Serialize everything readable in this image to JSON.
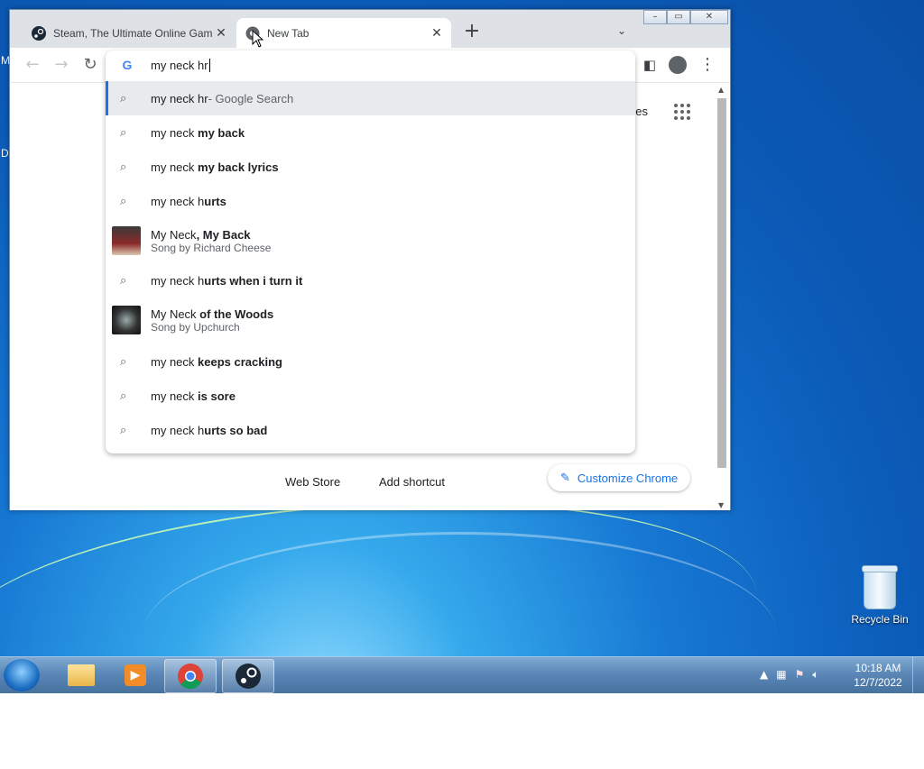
{
  "browser": {
    "tabs": [
      {
        "title": "Steam, The Ultimate Online Gam",
        "icon": "steam-icon"
      },
      {
        "title": "New Tab",
        "icon": "chrome-icon"
      }
    ],
    "omnibox": {
      "value": "my neck hr"
    },
    "suggestions": [
      {
        "type": "search",
        "typed": "my neck hr",
        "rest": "",
        "suffix": " - Google Search",
        "selected": true
      },
      {
        "type": "search",
        "typed": "my neck ",
        "rest": "my back"
      },
      {
        "type": "search",
        "typed": "my neck ",
        "rest": "my back lyrics"
      },
      {
        "type": "search",
        "typed": "my neck h",
        "rest": "urts"
      },
      {
        "type": "entity",
        "typed": "My Neck",
        "rest": ", My Back",
        "sub": "Song by Richard Cheese"
      },
      {
        "type": "search",
        "typed": "my neck h",
        "rest": "urts when i turn it"
      },
      {
        "type": "entity",
        "typed": "My Neck",
        "rest": " of the Woods",
        "sub": "Song by Upchurch"
      },
      {
        "type": "search",
        "typed": "my neck ",
        "rest": "keeps cracking"
      },
      {
        "type": "search",
        "typed": "my neck ",
        "rest": "is sore"
      },
      {
        "type": "search",
        "typed": "my neck h",
        "rest": "urts so bad"
      }
    ],
    "page": {
      "images_fragment": "ges",
      "web_store": "Web Store",
      "add_shortcut": "Add shortcut",
      "customize": "Customize Chrome"
    },
    "accent": "#1a73e8"
  },
  "desktop": {
    "edge_letters": [
      "M",
      "D"
    ],
    "recycle_bin": "Recycle Bin"
  },
  "taskbar": {
    "time": "10:18 AM",
    "date": "12/7/2022",
    "pinned": [
      "start-button",
      "explorer",
      "media-player",
      "chrome",
      "steam"
    ]
  }
}
